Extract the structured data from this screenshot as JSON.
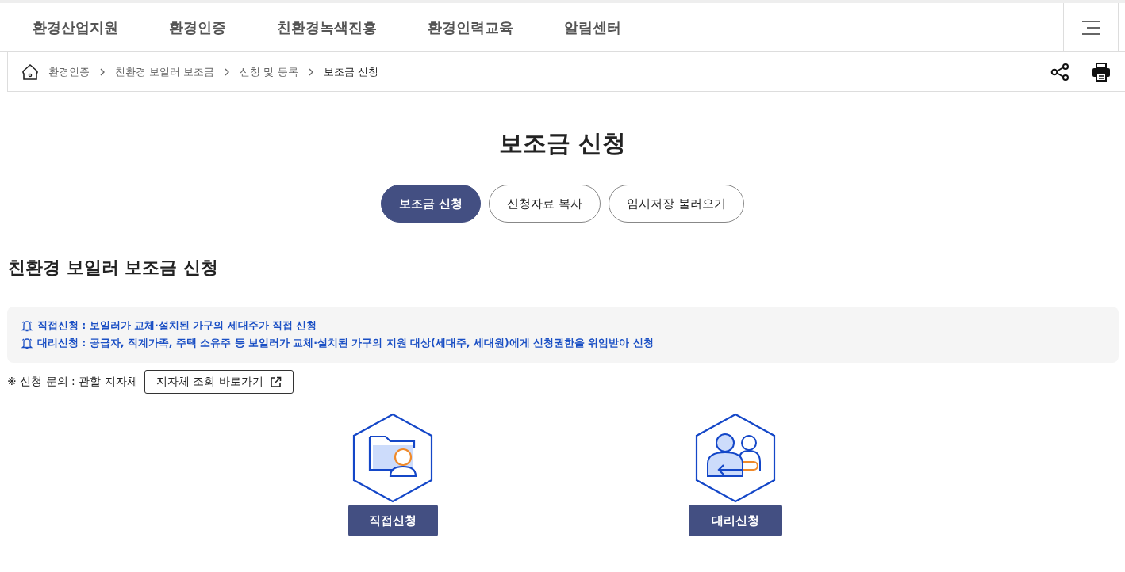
{
  "nav": {
    "items": [
      "환경산업지원",
      "환경인증",
      "친환경녹색진흥",
      "환경인력교육",
      "알림센터"
    ]
  },
  "breadcrumb": [
    "환경인증",
    "친환경 보일러 보조금",
    "신청 및 등록",
    "보조금 신청"
  ],
  "page_title": "보조금 신청",
  "tabs": [
    {
      "label": "보조금 신청",
      "selected": true
    },
    {
      "label": "신청자료 복사",
      "selected": false
    },
    {
      "label": "임시저장 불러오기",
      "selected": false
    }
  ],
  "section_title": "친환경 보일러 보조금 신청",
  "notices": [
    "직접신청 : 보일러가 교체·설치된 가구의 세대주가 직접 신청",
    "대리신청 : 공급자, 직계가족, 주택 소유주 등 보일러가 교체·설치된 가구의 지원 대상(세대주, 세대원)에게 신청권한을 위임받아 신청"
  ],
  "inquiry": {
    "text": "※ 신청 문의 : 관할 지자체",
    "link": "지자체 조회 바로가기"
  },
  "options": [
    {
      "kind": "direct",
      "label": "직접신청"
    },
    {
      "kind": "proxy",
      "label": "대리신청"
    }
  ]
}
